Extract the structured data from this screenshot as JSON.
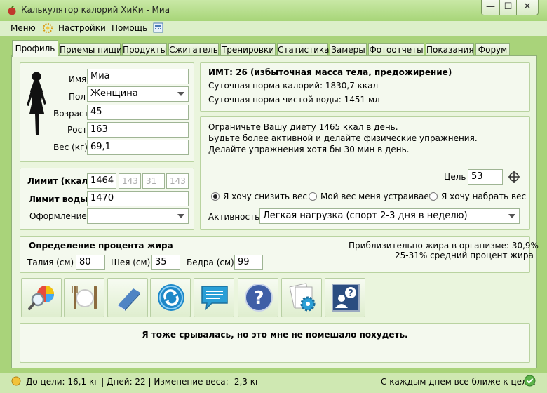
{
  "window": {
    "title": "Калькулятор калорий ХиКи - Миа",
    "min": "—",
    "max": "☐",
    "close": "✕"
  },
  "menu": {
    "items": [
      "Меню",
      "Настройки",
      "Помощь"
    ]
  },
  "tabs": [
    "Профиль",
    "Приемы пищи",
    "Продукты",
    "Сжигатель",
    "Тренировки",
    "Статистика",
    "Замеры",
    "Фотоотчеты",
    "Показания",
    "Форум"
  ],
  "profile": {
    "name_label": "Имя",
    "name": "Миа",
    "sex_label": "Пол",
    "sex": "Женщина",
    "age_label": "Возраст",
    "age": "45",
    "height_label": "Рост",
    "height": "163",
    "weight_label": "Вес (кг)",
    "weight": "69,1"
  },
  "limits": {
    "kcal_label": "Лимит (ккал)",
    "kcal": "1464",
    "p": "143",
    "f": "31",
    "c": "143",
    "water_label": "Лимит воды",
    "water": "1470",
    "style_label": "Оформление",
    "style": ""
  },
  "bmi": {
    "title": "ИМТ: 26 (избыточная масса тела, предожирение)",
    "calories": "Суточная норма калорий: 1830,7 ккал",
    "water": "Суточная норма чистой воды: 1451 мл"
  },
  "advice": {
    "lines": [
      "Ограничьте Вашу диету 1465 ккал в день.",
      "Будьте более активной и делайте физические упражнения.",
      "Делайте упражнения хотя бы 30 мин в день."
    ],
    "goal_label": "Цель",
    "goal": "53",
    "radios": [
      "Я хочу снизить вес",
      "Мой вес меня устраивает",
      "Я хочу набрать вес"
    ],
    "selected_radio": 0,
    "activity_label": "Активность",
    "activity": "Легкая нагрузка (спорт 2-3 дня в неделю)"
  },
  "fat": {
    "title": "Определение процента жира",
    "waist_label": "Талия (см)",
    "waist": "80",
    "neck_label": "Шея (см)",
    "neck": "35",
    "hips_label": "Бедра (см)",
    "hips": "99",
    "result1": "Приблизительно жира в организме: 30,9%",
    "result2": "25-31% средний процент жира"
  },
  "toolbar": {
    "icons": [
      "food-search-icon",
      "cutlery-icon",
      "book-icon",
      "sync-icon",
      "chat-icon",
      "help-icon",
      "settings-icon",
      "support-icon"
    ]
  },
  "quote": "Я тоже срывалась, но это мне не помешало похудеть.",
  "status": {
    "left": "До цели: 16,1 кг | Дней: 22 | Изменение веса: -2,3 кг",
    "right": "С каждым днем все ближе к цели!"
  },
  "colors": {
    "background": "#a9d37a",
    "panel": "#eaf5dd",
    "accent": "#1e88c8"
  }
}
